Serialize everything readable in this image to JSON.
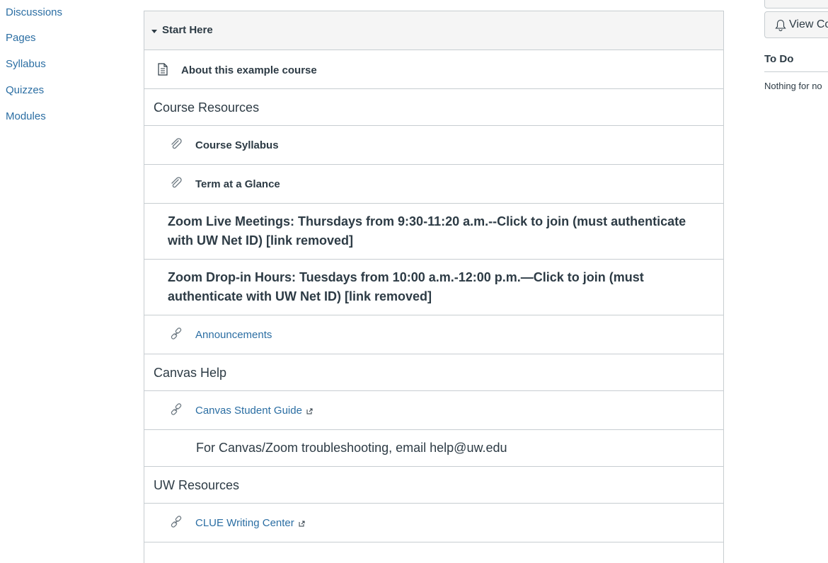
{
  "course_nav": {
    "items": [
      {
        "label": "Discussions"
      },
      {
        "label": "Pages"
      },
      {
        "label": "Syllabus"
      },
      {
        "label": "Quizzes"
      },
      {
        "label": "Modules"
      }
    ]
  },
  "module": {
    "title": "Start Here",
    "rows": [
      {
        "type": "page",
        "icon": "document-icon",
        "title": "About this example course"
      },
      {
        "type": "subheader",
        "title": "Course Resources"
      },
      {
        "type": "file",
        "icon": "paperclip-icon",
        "title": "Course Syllabus"
      },
      {
        "type": "file",
        "icon": "paperclip-icon",
        "title": "Term at a Glance"
      },
      {
        "type": "text",
        "title": "Zoom Live Meetings: Thursdays from 9:30-11:20 a.m.--Click to join (must authenticate with UW Net ID) [link removed]"
      },
      {
        "type": "text",
        "title": "Zoom Drop-in Hours: Tuesdays from 10:00 a.m.-12:00 p.m.—Click to join (must authenticate with UW Net ID) [link removed]"
      },
      {
        "type": "link",
        "icon": "link-icon",
        "title": "Announcements"
      },
      {
        "type": "subheader",
        "title": "Canvas Help"
      },
      {
        "type": "link",
        "icon": "link-icon",
        "title": "Canvas Student Guide",
        "external": true
      },
      {
        "type": "text",
        "title": "For Canvas/Zoom troubleshooting, email help@uw.edu"
      },
      {
        "type": "subheader",
        "title": "UW Resources"
      },
      {
        "type": "link",
        "icon": "link-icon",
        "title": "CLUE Writing Center",
        "external": true
      }
    ]
  },
  "sidebar": {
    "view_button_label": "View Co",
    "todo_title": "To Do",
    "todo_empty": "Nothing for no"
  },
  "colors": {
    "link": "#2b6ea3",
    "text": "#2d3b45",
    "border": "#c7cdd1",
    "header_bg": "#f5f5f5"
  }
}
